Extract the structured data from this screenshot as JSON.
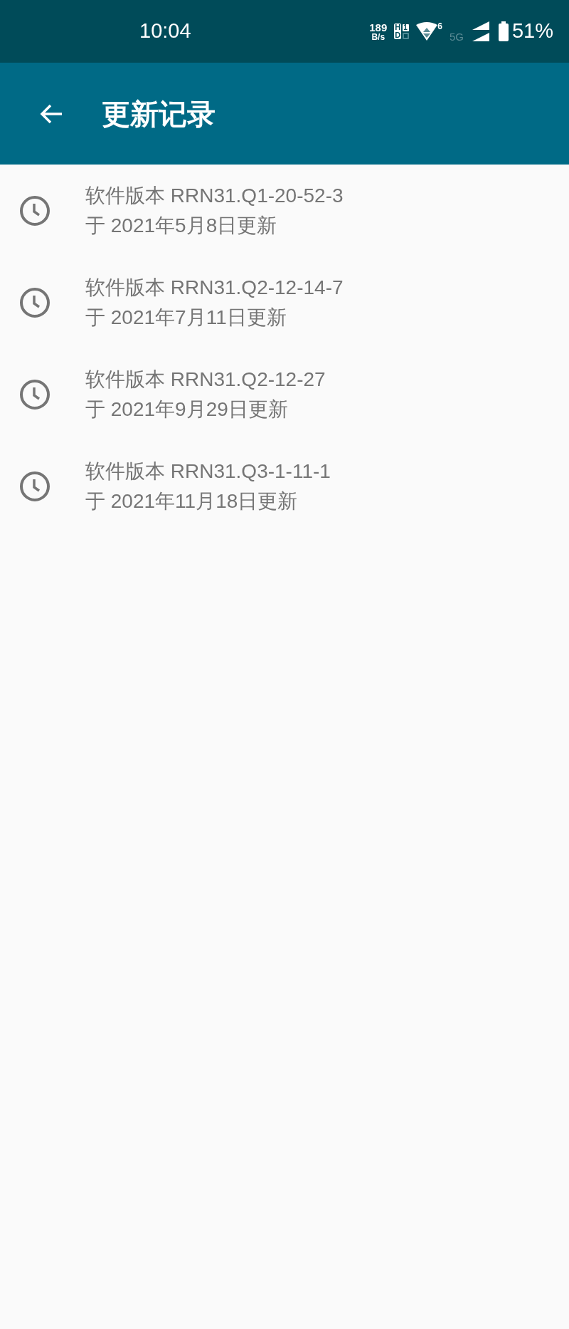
{
  "status_bar": {
    "time": "10:04",
    "net_speed": "189",
    "net_unit": "B/s",
    "hd_top": "H",
    "hd_bottom": "D",
    "sim_slot": "1",
    "wifi_badge": "6",
    "network_type": "5G",
    "battery": "51%"
  },
  "app_bar": {
    "title": "更新记录"
  },
  "updates": [
    {
      "version": "软件版本 RRN31.Q1-20-52-3",
      "date": "于 2021年5月8日更新"
    },
    {
      "version": "软件版本 RRN31.Q2-12-14-7",
      "date": "于 2021年7月11日更新"
    },
    {
      "version": "软件版本 RRN31.Q2-12-27",
      "date": "于 2021年9月29日更新"
    },
    {
      "version": "软件版本 RRN31.Q3-1-11-1",
      "date": "于 2021年11月18日更新"
    }
  ]
}
